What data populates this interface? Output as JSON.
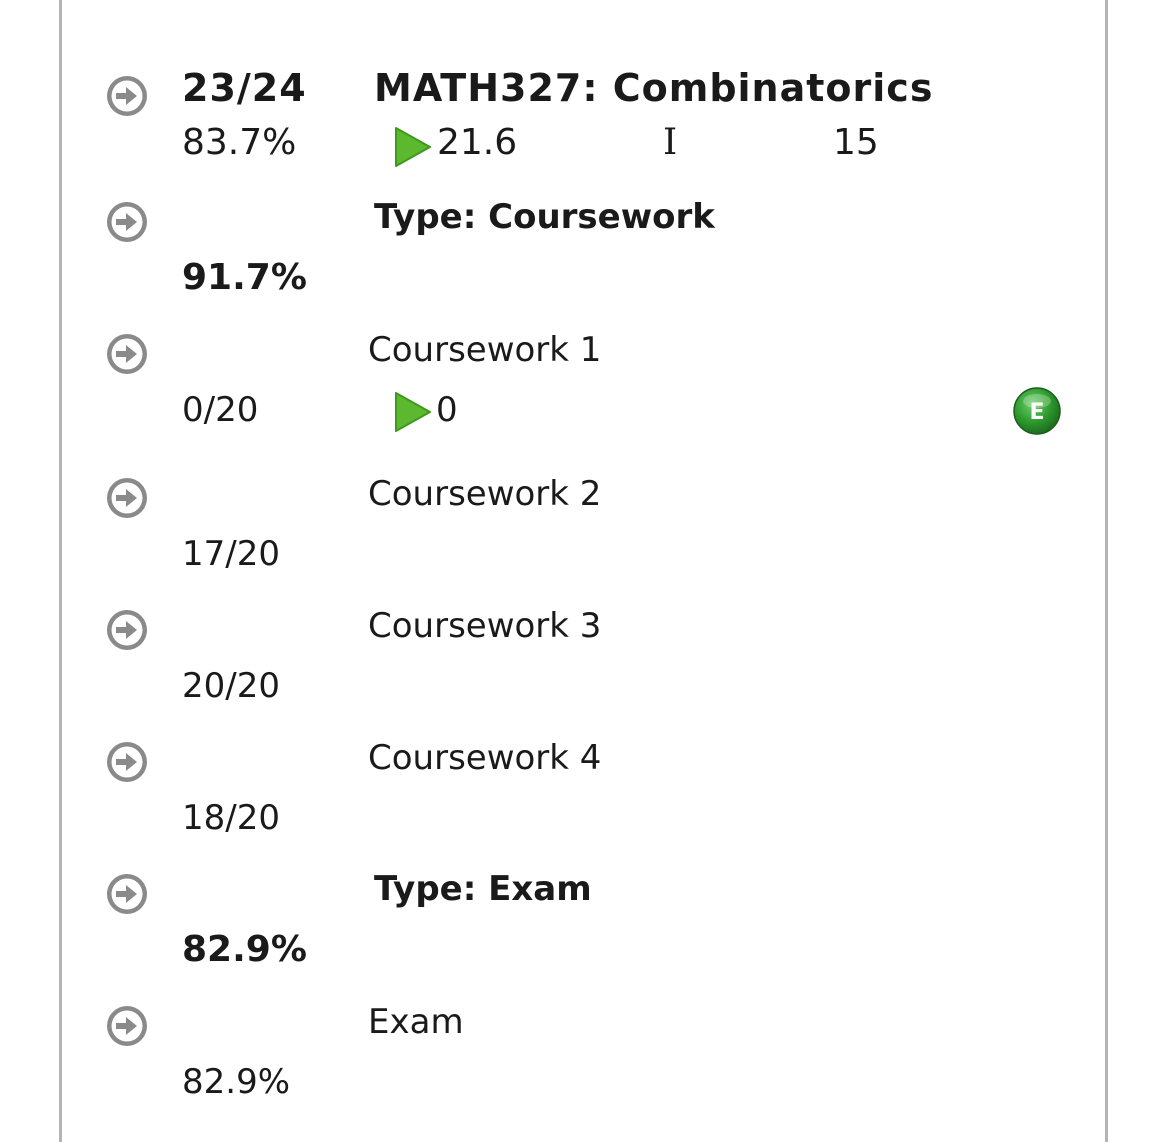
{
  "course": {
    "score": "23/24",
    "title": "MATH327: Combinatorics",
    "percent": "83.7%",
    "value": "21.6",
    "flag": "I",
    "number": "15"
  },
  "type_coursework": {
    "label": "Type: Coursework",
    "percent": "91.7%"
  },
  "coursework_1": {
    "name": "Coursework 1",
    "score": "0/20",
    "value": "0",
    "badge": "E"
  },
  "coursework_2": {
    "name": "Coursework 2",
    "score": "17/20"
  },
  "coursework_3": {
    "name": "Coursework 3",
    "score": "20/20"
  },
  "coursework_4": {
    "name": "Coursework 4",
    "score": "18/20"
  },
  "type_exam": {
    "label": "Type: Exam",
    "percent": "82.9%"
  },
  "exam": {
    "name": "Exam",
    "percent": "82.9%"
  },
  "icons": {
    "row_expand": "arrow-right-circle-icon",
    "play": "play-triangle-icon",
    "badge": "e-circle-icon"
  },
  "colors": {
    "arrow_gray": "#8a8a8a",
    "play_green": "#5cb82e",
    "badge_green": "#2e9a2e",
    "border": "#b4b4b4"
  }
}
